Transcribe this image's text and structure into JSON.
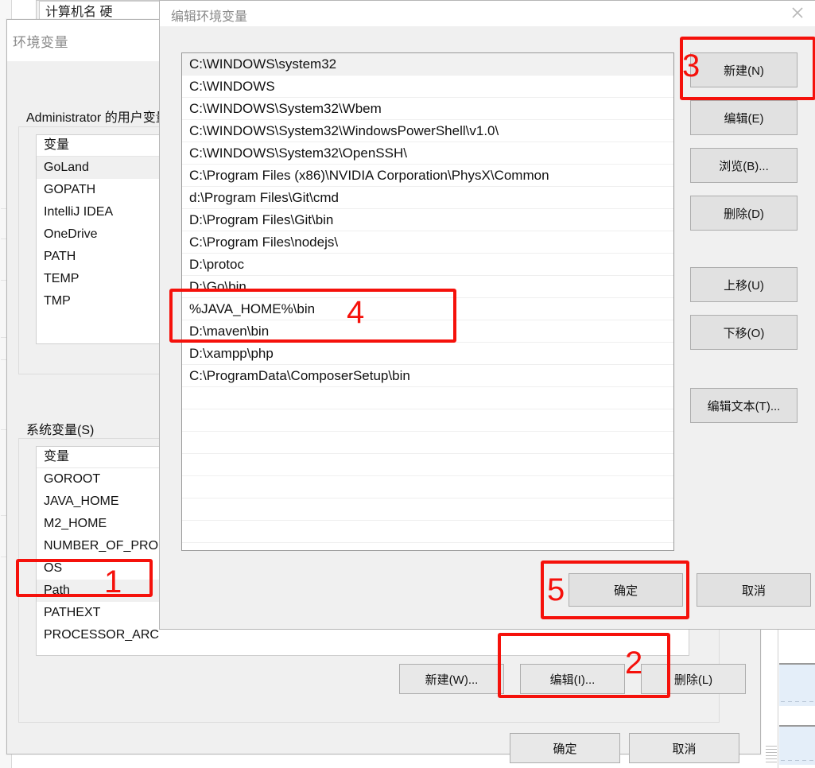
{
  "background_app": {
    "name": "background-window"
  },
  "system_properties": {
    "tab_label": "计算机名  硬"
  },
  "env_dialog": {
    "title": "环境变量",
    "user_section_label": "Administrator 的用户变量",
    "system_section_label": "系统变量(S)",
    "column_header": "变量",
    "user_variables": [
      "GoLand",
      "GOPATH",
      "IntelliJ IDEA",
      "OneDrive",
      "PATH",
      "TEMP",
      "TMP"
    ],
    "user_selected": "GoLand",
    "system_variables": [
      "GOROOT",
      "JAVA_HOME",
      "M2_HOME",
      "NUMBER_OF_PRO",
      "OS",
      "Path",
      "PATHEXT",
      "PROCESSOR_ARC"
    ],
    "system_selected": "Path",
    "system_buttons": {
      "new": "新建(W)...",
      "edit": "编辑(I)...",
      "delete": "删除(L)"
    },
    "footer_buttons": {
      "ok": "确定",
      "cancel": "取消"
    }
  },
  "edit_dialog": {
    "title": "编辑环境变量",
    "close_icon": "close-icon",
    "selected_entry": "C:\\WINDOWS\\system32",
    "path_entries": [
      "C:\\WINDOWS\\system32",
      "C:\\WINDOWS",
      "C:\\WINDOWS\\System32\\Wbem",
      "C:\\WINDOWS\\System32\\WindowsPowerShell\\v1.0\\",
      "C:\\WINDOWS\\System32\\OpenSSH\\",
      "C:\\Program Files (x86)\\NVIDIA Corporation\\PhysX\\Common",
      "d:\\Program Files\\Git\\cmd",
      "D:\\Program Files\\Git\\bin",
      "C:\\Program Files\\nodejs\\",
      "D:\\protoc",
      "D:\\Go\\bin",
      "%JAVA_HOME%\\bin",
      "D:\\maven\\bin",
      "D:\\xampp\\php",
      "C:\\ProgramData\\ComposerSetup\\bin"
    ],
    "highlighted_entry": "%JAVA_HOME%\\bin",
    "side_buttons": {
      "new": "新建(N)",
      "edit": "编辑(E)",
      "browse": "浏览(B)...",
      "delete": "删除(D)",
      "move_up": "上移(U)",
      "move_down": "下移(O)",
      "edit_text": "编辑文本(T)..."
    },
    "footer_buttons": {
      "ok": "确定",
      "cancel": "取消"
    }
  },
  "annotations": {
    "accent_color": "#f5110b",
    "steps": [
      {
        "number": "1",
        "target": "system-variable-path"
      },
      {
        "number": "2",
        "target": "system-edit-button"
      },
      {
        "number": "3",
        "target": "edit-dialog-new-button"
      },
      {
        "number": "4",
        "target": "path-entry-java-home"
      },
      {
        "number": "5",
        "target": "edit-dialog-ok-button"
      }
    ]
  }
}
